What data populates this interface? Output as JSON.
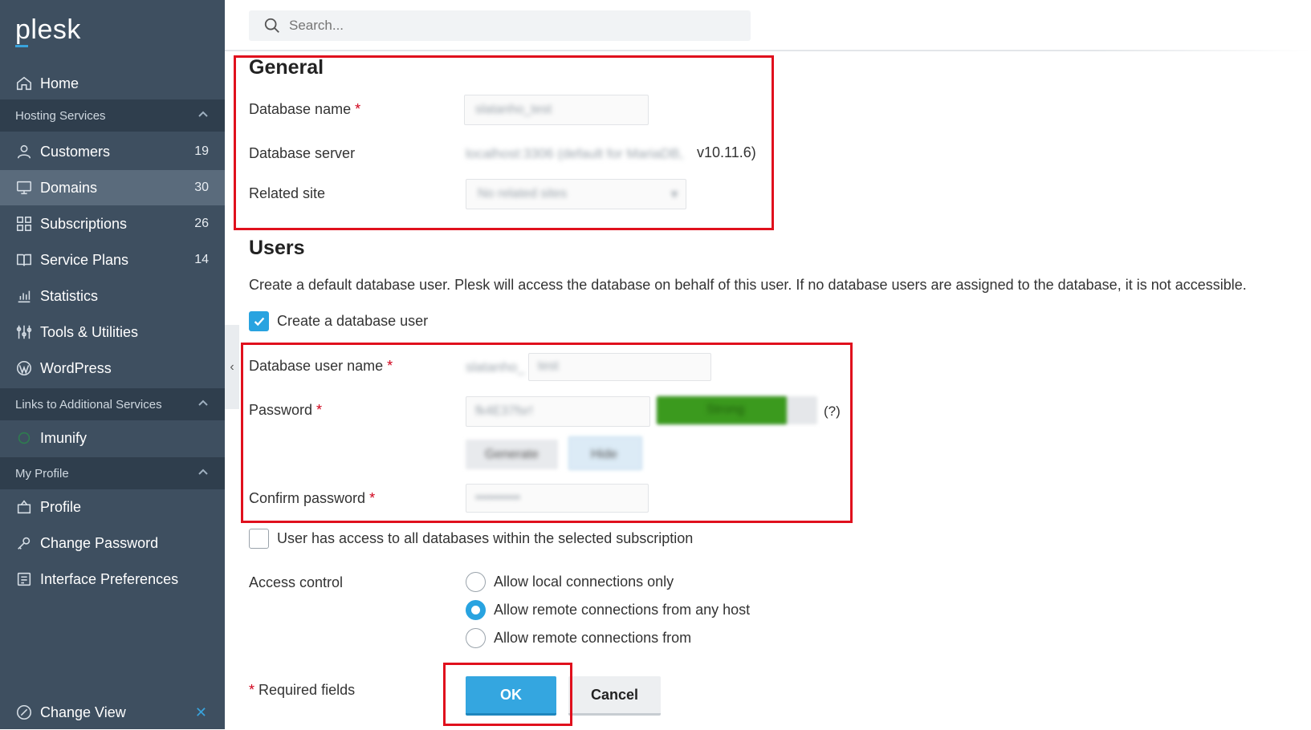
{
  "brand": {
    "logo_text": "plesk",
    "accent": "#39a3dc"
  },
  "sidebar": {
    "home": {
      "label": "Home",
      "icon": "home-icon"
    },
    "sections": {
      "hosting": "Hosting Services",
      "links": "Links to Additional Services",
      "profile": "My Profile"
    },
    "hosting_items": [
      {
        "label": "Customers",
        "count": "19",
        "icon": "user-icon"
      },
      {
        "label": "Domains",
        "count": "30",
        "icon": "monitor-icon",
        "active": true
      },
      {
        "label": "Subscriptions",
        "count": "26",
        "icon": "grid-icon"
      },
      {
        "label": "Service Plans",
        "count": "14",
        "icon": "book-icon"
      },
      {
        "label": "Statistics",
        "count": "",
        "icon": "bar-chart-icon"
      },
      {
        "label": "Tools & Utilities",
        "count": "",
        "icon": "sliders-icon"
      },
      {
        "label": "WordPress",
        "count": "",
        "icon": "wordpress-icon"
      }
    ],
    "links_items": [
      {
        "label": "Imunify",
        "icon": "imunify-icon"
      }
    ],
    "profile_items": [
      {
        "label": "Profile",
        "icon": "profile-icon"
      },
      {
        "label": "Change Password",
        "icon": "key-icon"
      },
      {
        "label": "Interface Preferences",
        "icon": "preferences-icon"
      }
    ],
    "change_view": {
      "label": "Change View",
      "icon": "change-view-icon",
      "close": "✕"
    }
  },
  "search": {
    "placeholder": "Search..."
  },
  "general": {
    "heading": "General",
    "database_name_label": "Database name",
    "database_name_value": "slatanho_test",
    "database_server_label": "Database server",
    "database_server_blurred": "localhost:3306 (default for MariaDB,",
    "database_server_version": " v10.11.6)",
    "related_site_label": "Related site",
    "related_site_value": "No related sites"
  },
  "users": {
    "heading": "Users",
    "description": "Create a default database user. Plesk will access the database on behalf of this user. If no database users are assigned to the database, it is not accessible.",
    "create_user_label": "Create a database user",
    "create_user_checked": true,
    "user_name_label": "Database user name",
    "user_name_prefix": "slatanho_",
    "user_name_value": "test",
    "password_label": "Password",
    "password_value": "fk4E37fsr!",
    "password_strength": "Strong",
    "password_help": "(?)",
    "generate_label": "Generate",
    "hide_label": "Hide",
    "confirm_password_label": "Confirm password",
    "confirm_password_value": "••••••••••",
    "all_databases_label": "User has access to all databases within the selected subscription",
    "all_databases_checked": false,
    "access_control_label": "Access control",
    "access_options": [
      {
        "label": "Allow local connections only",
        "selected": false
      },
      {
        "label": "Allow remote connections from any host",
        "selected": true
      },
      {
        "label": "Allow remote connections from",
        "selected": false
      }
    ]
  },
  "footer": {
    "required_mark": "*",
    "required_text": " Required fields",
    "ok_label": "OK",
    "cancel_label": "Cancel"
  },
  "required_marker": "*",
  "colors": {
    "sidebar_bg": "#3e4f60",
    "section_bg": "#2f3e4d",
    "active_bg": "#5a6b7c",
    "primary": "#34a6e0",
    "highlight": "#e0101d",
    "required": "#d0021b",
    "strength": "#3b9a1e"
  }
}
